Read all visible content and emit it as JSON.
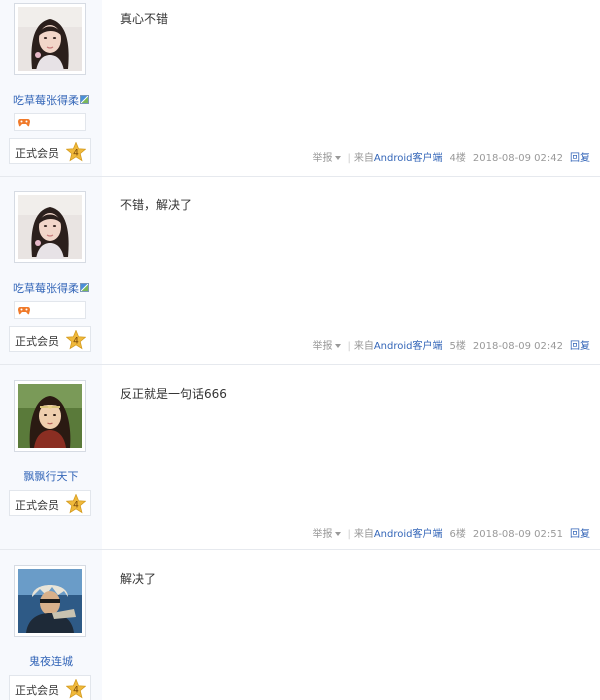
{
  "posts": [
    {
      "username": "吃草莓张得柔",
      "show_edit_icon": true,
      "show_game_badge": true,
      "role": "正式会员",
      "level": "4",
      "content": "真心不错",
      "footer": {
        "report": "举报",
        "from_prefix": "来自",
        "client": "Android客户端",
        "floor": "4楼",
        "time": "2018-08-09 02:42",
        "reply": "回复"
      }
    },
    {
      "username": "吃草莓张得柔",
      "show_edit_icon": true,
      "show_game_badge": true,
      "role": "正式会员",
      "level": "4",
      "content": "不错，解决了",
      "footer": {
        "report": "举报",
        "from_prefix": "来自",
        "client": "Android客户端",
        "floor": "5楼",
        "time": "2018-08-09 02:42",
        "reply": "回复"
      }
    },
    {
      "username": "飘飘行天下",
      "show_edit_icon": false,
      "show_game_badge": false,
      "role": "正式会员",
      "level": "4",
      "content": "反正就是一句话666",
      "footer": {
        "report": "举报",
        "from_prefix": "来自",
        "client": "Android客户端",
        "floor": "6楼",
        "time": "2018-08-09 02:51",
        "reply": "回复"
      }
    },
    {
      "username": "鬼夜连城",
      "show_edit_icon": false,
      "show_game_badge": false,
      "role": "正式会员",
      "level": "4",
      "content": "解决了"
    }
  ],
  "icons": {
    "level_star": "star-icon",
    "game_badge": "gamepad-icon",
    "edit": "edit-icon",
    "dropdown": "caret-down-icon"
  },
  "colors": {
    "link": "#3466b8",
    "sidebar_bg": "#f7f9fd",
    "muted": "#999999",
    "star": "#f0b93b"
  }
}
